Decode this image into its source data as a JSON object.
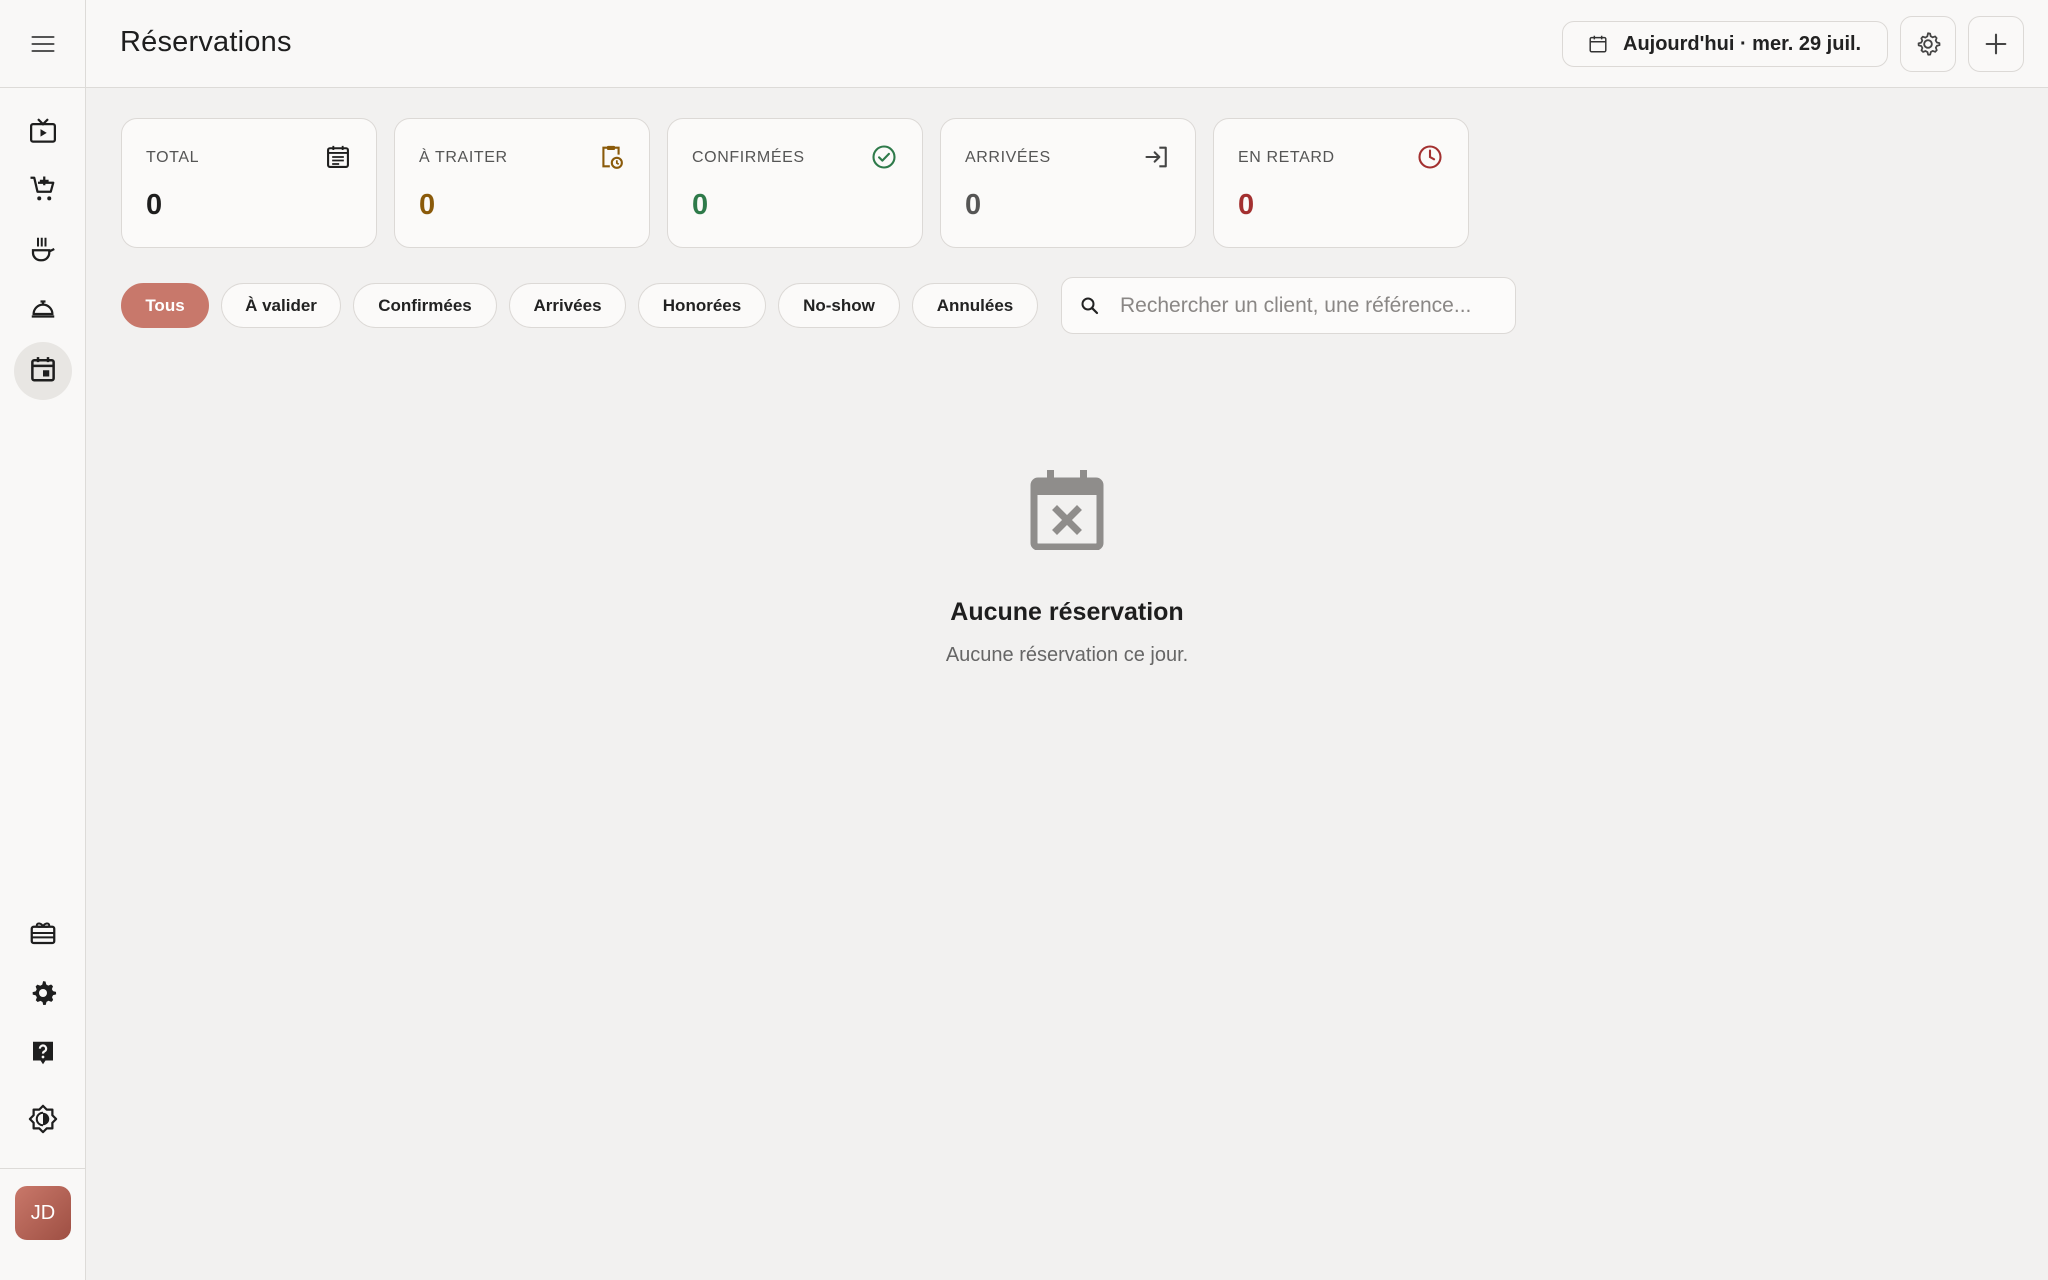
{
  "header": {
    "title": "Réservations",
    "date_label": "Aujourd'hui · mer. 29 juil."
  },
  "sidebar": {
    "items": [
      {
        "name": "display",
        "icon": "tv-play-icon"
      },
      {
        "name": "orders",
        "icon": "cart-add-icon"
      },
      {
        "name": "kitchen",
        "icon": "cooking-pot-icon"
      },
      {
        "name": "service",
        "icon": "room-service-icon"
      },
      {
        "name": "reservations",
        "icon": "calendar-event-icon",
        "active": true
      }
    ],
    "bottom_items": [
      {
        "name": "gift-cards",
        "icon": "card-giftcard-icon"
      },
      {
        "name": "settings",
        "icon": "gear-icon"
      },
      {
        "name": "help",
        "icon": "help-icon"
      },
      {
        "name": "theme",
        "icon": "brightness-icon"
      }
    ],
    "avatar_initials": "JD"
  },
  "stats": [
    {
      "label": "TOTAL",
      "value": "0",
      "color": "#1e1e1e",
      "icon": "calendar-list-icon"
    },
    {
      "label": "À TRAITER",
      "value": "0",
      "color": "#8a5a0a",
      "icon": "clipboard-clock-icon"
    },
    {
      "label": "CONFIRMÉES",
      "value": "0",
      "color": "#2e7a4a",
      "icon": "check-circle-icon"
    },
    {
      "label": "ARRIVÉES",
      "value": "0",
      "color": "#555555",
      "icon": "login-icon"
    },
    {
      "label": "EN RETARD",
      "value": "0",
      "color": "#a33030",
      "icon": "clock-icon"
    }
  ],
  "filters": [
    {
      "label": "Tous",
      "active": true
    },
    {
      "label": "À valider"
    },
    {
      "label": "Confirmées"
    },
    {
      "label": "Arrivées"
    },
    {
      "label": "Honorées"
    },
    {
      "label": "No-show"
    },
    {
      "label": "Annulées"
    }
  ],
  "search": {
    "placeholder": "Rechercher un client, une référence..."
  },
  "empty_state": {
    "title": "Aucune réservation",
    "subtitle": "Aucune réservation ce jour."
  },
  "colors": {
    "accent": "#c8786b",
    "background": "#f2f1f0",
    "surface": "#fbfaf9"
  }
}
